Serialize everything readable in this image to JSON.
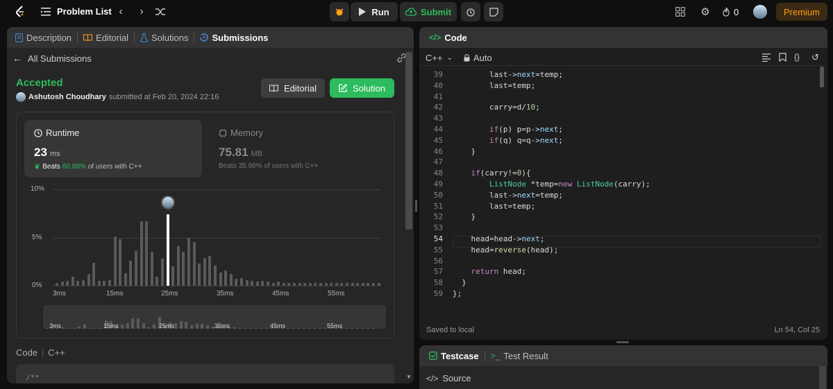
{
  "topbar": {
    "problem_list": "Problem List",
    "run": "Run",
    "submit": "Submit",
    "streak": "0",
    "premium": "Premium"
  },
  "left": {
    "tabs": [
      "Description",
      "Editorial",
      "Solutions",
      "Submissions"
    ],
    "all_submissions": "All Submissions",
    "status": "Accepted",
    "user": "Ashutosh Choudhary",
    "submitted_at": "submitted at Feb 20, 2024 22:16",
    "editorial_btn": "Editorial",
    "solution_btn": "Solution",
    "runtime": {
      "label": "Runtime",
      "value": "23",
      "unit": "ms",
      "beats_prefix": "Beats",
      "beats_pct": "60.88%",
      "beats_suffix": "of users with C++"
    },
    "memory": {
      "label": "Memory",
      "value": "75.81",
      "unit": "MB",
      "beats_prefix": "Beats",
      "beats_pct": "35.98%",
      "beats_suffix": "of users with C++"
    },
    "code_label": "Code",
    "lang": "C++",
    "code_first": "/**"
  },
  "chart_data": {
    "type": "bar",
    "y_ticks": [
      "10%",
      "5%",
      "0%"
    ],
    "ylim": [
      0,
      10
    ],
    "x_ticks": [
      "3ms",
      "15ms",
      "25ms",
      "35ms",
      "45ms",
      "55ms"
    ],
    "mini_x_ticks": [
      "3ms",
      "15ms",
      "25ms",
      "35ms",
      "45ms",
      "55ms"
    ],
    "values": [
      0.3,
      0.4,
      0.5,
      0.9,
      0.5,
      0.6,
      1.2,
      2.4,
      0.5,
      0.5,
      0.6,
      5.1,
      4.8,
      1.3,
      2.6,
      3.6,
      6.7,
      6.7,
      3.5,
      0.9,
      2.8,
      7.4,
      2.0,
      4.1,
      3.5,
      5.0,
      4.5,
      2.3,
      2.9,
      3.1,
      2.1,
      1.4,
      1.6,
      1.2,
      0.7,
      0.8,
      0.6,
      0.5,
      0.4,
      0.5,
      0.4,
      0.3,
      0.4,
      0.3,
      0.3,
      0.3,
      0.3,
      0.3,
      0.3,
      0.3,
      0.3,
      0.3,
      0.3,
      0.3,
      0.3,
      0.3,
      0.3,
      0.3,
      0.3,
      0.3,
      0.3,
      0.3
    ],
    "highlight_index": 21
  },
  "right": {
    "code_title": "Code",
    "lang": "C++",
    "mode": "Auto",
    "saved": "Saved to local",
    "cursor": "Ln 54, Col 25",
    "testcase": "Testcase",
    "test_result": "Test Result",
    "source": "Source",
    "lines": [
      {
        "n": "39",
        "t": "        last->next=temp;"
      },
      {
        "n": "40",
        "t": "        last=temp;"
      },
      {
        "n": "41",
        "t": ""
      },
      {
        "n": "42",
        "t": "        carry=d/10;"
      },
      {
        "n": "43",
        "t": ""
      },
      {
        "n": "44",
        "t": "        if(p) p=p->next;"
      },
      {
        "n": "45",
        "t": "        if(q) q=q->next;"
      },
      {
        "n": "46",
        "t": "    }"
      },
      {
        "n": "47",
        "t": ""
      },
      {
        "n": "48",
        "t": "    if(carry!=0){"
      },
      {
        "n": "49",
        "t": "        ListNode *temp=new ListNode(carry);"
      },
      {
        "n": "50",
        "t": "        last->next=temp;"
      },
      {
        "n": "51",
        "t": "        last=temp;"
      },
      {
        "n": "52",
        "t": "    }"
      },
      {
        "n": "53",
        "t": ""
      },
      {
        "n": "54",
        "t": "    head=head->next;"
      },
      {
        "n": "55",
        "t": "    head=reverse(head);"
      },
      {
        "n": "56",
        "t": ""
      },
      {
        "n": "57",
        "t": "    return head;"
      },
      {
        "n": "58",
        "t": "  }"
      },
      {
        "n": "59",
        "t": "};"
      }
    ]
  }
}
